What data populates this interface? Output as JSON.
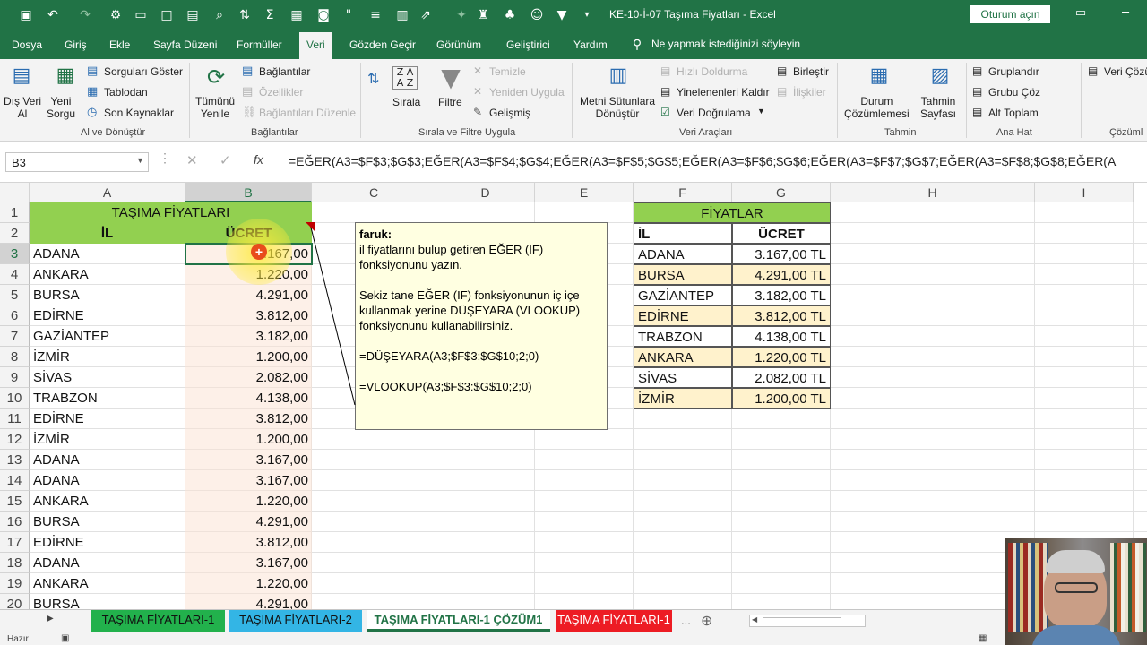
{
  "window": {
    "title": "KE-10-İ-07 Taşıma Fiyatları  -  Excel",
    "signin_label": "Oturum açın"
  },
  "tabs": [
    "Dosya",
    "Giriş",
    "Ekle",
    "Sayfa Düzeni",
    "Formüller",
    "Veri",
    "Gözden Geçir",
    "Görünüm",
    "Geliştirici",
    "Yardım"
  ],
  "active_tab": "Veri",
  "tellme": "Ne yapmak istediğinizi söyleyin",
  "ribbon": {
    "dis_veri_al": "Dış Veri\nAl",
    "yeni_sorgu": "Yeni\nSorgu",
    "sorgulari_goster": "Sorguları Göster",
    "tablodan": "Tablodan",
    "son_kaynaklar": "Son Kaynaklar",
    "group_al": "Al ve Dönüştür",
    "tumunu_yenile": "Tümünü\nYenile",
    "baglantilar": "Bağlantılar",
    "ozellikler": "Özellikler",
    "baglantilari_duzenle": "Bağlantıları Düzenle",
    "group_baglantilar": "Bağlantılar",
    "sirala": "Sırala",
    "filtre": "Filtre",
    "temizle": "Temizle",
    "yeniden_uygula": "Yeniden Uygula",
    "gelismis": "Gelişmiş",
    "group_sirala": "Sırala ve Filtre Uygula",
    "metni_sutunlara": "Metni Sütunlara\nDönüştür",
    "hizli_doldurma": "Hızlı Doldurma",
    "yinelenenleri_kaldir": "Yinelenenleri Kaldır",
    "veri_dogrulama": "Veri Doğrulama",
    "birlestir": "Birleştir",
    "iliskiler": "İlişkiler",
    "group_veri_araclari": "Veri Araçları",
    "durum": "Durum\nÇözümlemesi",
    "tahmin": "Tahmin\nSayfası",
    "group_tahmin": "Tahmin",
    "gruplandir": "Gruplandır",
    "grubu_coz": "Grubu Çöz",
    "alt_toplam": "Alt Toplam",
    "group_ana_hat": "Ana Hat",
    "veri_cozumle": "Veri Çözü",
    "group_cozumle": "Çözüml"
  },
  "namebox": "B3",
  "formula": "=EĞER(A3=$F$3;$G$3;EĞER(A3=$F$4;$G$4;EĞER(A3=$F$5;$G$5;EĞER(A3=$F$6;$G$6;EĞER(A3=$F$7;$G$7;EĞER(A3=$F$8;$G$8;EĞER(A",
  "columns": [
    "A",
    "B",
    "C",
    "D",
    "E",
    "F",
    "G",
    "H",
    "I"
  ],
  "rows": [
    "1",
    "2",
    "3",
    "4",
    "5",
    "6",
    "7",
    "8",
    "9",
    "10",
    "11",
    "12",
    "13",
    "14",
    "15",
    "16",
    "17",
    "18",
    "19",
    "20"
  ],
  "left_table": {
    "title": "TAŞIMA FİYATLARI",
    "header_il": "İL",
    "header_ucret": "ÜCRET",
    "rows": [
      [
        "ADANA",
        "3.167,00"
      ],
      [
        "ANKARA",
        "1.220,00"
      ],
      [
        "BURSA",
        "4.291,00"
      ],
      [
        "EDİRNE",
        "3.812,00"
      ],
      [
        "GAZİANTEP",
        "3.182,00"
      ],
      [
        "İZMİR",
        "1.200,00"
      ],
      [
        "SİVAS",
        "2.082,00"
      ],
      [
        "TRABZON",
        "4.138,00"
      ],
      [
        "EDİRNE",
        "3.812,00"
      ],
      [
        "İZMİR",
        "1.200,00"
      ],
      [
        "ADANA",
        "3.167,00"
      ],
      [
        "ADANA",
        "3.167,00"
      ],
      [
        "ANKARA",
        "1.220,00"
      ],
      [
        "BURSA",
        "4.291,00"
      ],
      [
        "EDİRNE",
        "3.812,00"
      ],
      [
        "ADANA",
        "3.167,00"
      ],
      [
        "ANKARA",
        "1.220,00"
      ],
      [
        "BURSA",
        "4.291,00"
      ]
    ]
  },
  "right_table": {
    "title": "FİYATLAR",
    "header_il": "İL",
    "header_ucret": "ÜCRET",
    "rows": [
      [
        "ADANA",
        "3.167,00 TL"
      ],
      [
        "BURSA",
        "4.291,00 TL"
      ],
      [
        "GAZİANTEP",
        "3.182,00 TL"
      ],
      [
        "EDİRNE",
        "3.812,00 TL"
      ],
      [
        "TRABZON",
        "4.138,00 TL"
      ],
      [
        "ANKARA",
        "1.220,00 TL"
      ],
      [
        "SİVAS",
        "2.082,00 TL"
      ],
      [
        "İZMİR",
        "1.200,00 TL"
      ]
    ]
  },
  "comment": {
    "author": "faruk:",
    "lines": [
      "il fiyatlarını bulup getiren EĞER (IF)",
      "fonksiyonunu yazın.",
      "",
      "Sekiz tane EĞER (IF) fonksiyonunun iç içe",
      "kullanmak yerine DÜŞEYARA (VLOOKUP)",
      "fonksiyonunu kullanabilirsiniz.",
      "",
      "=DÜŞEYARA(A3;$F$3:$G$10;2;0)",
      "",
      "=VLOOKUP(A3;$F$3:$G$10;2;0)"
    ]
  },
  "sheets": [
    {
      "name": "TAŞIMA FİYATLARI-1",
      "color": "#22b14c"
    },
    {
      "name": "TAŞIMA FİYATLARI-2",
      "color": "#33b5e5"
    },
    {
      "name": "TAŞIMA FİYATLARI-1 ÇÖZÜM1",
      "color": "#ffffff"
    },
    {
      "name": "TAŞIMA FİYATLARI-1",
      "color": "#ed1c24"
    }
  ],
  "status": "Hazır",
  "colors": {
    "excel_green": "#217346",
    "header_green": "#92d050",
    "row_beige": "#fce4d6",
    "right_header_fill": "#fff2cc"
  }
}
